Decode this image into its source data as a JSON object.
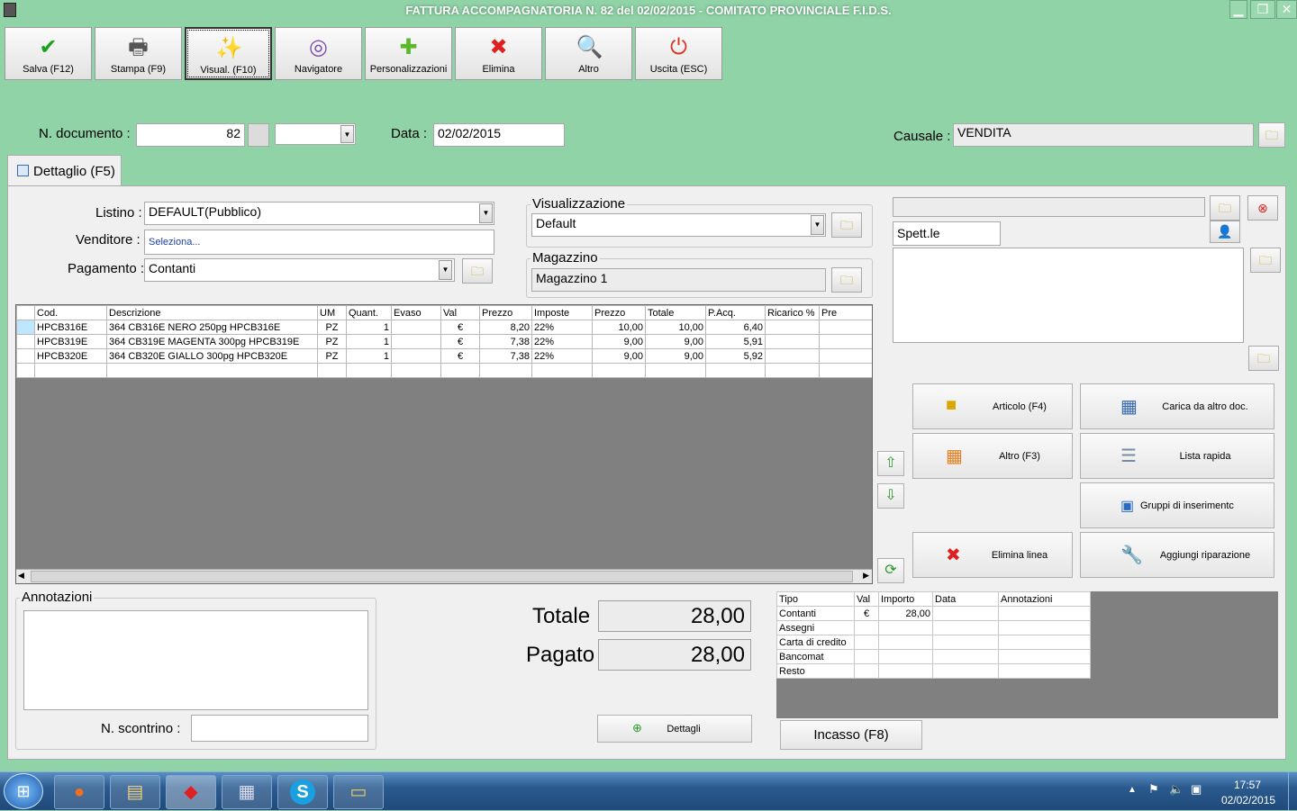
{
  "window": {
    "title": "FATTURA ACCOMPAGNATORIA N. 82 del 02/02/2015 - COMITATO PROVINCIALE F.I.D.S."
  },
  "toolbar": [
    {
      "label": "Salva (F12)",
      "icon": "check-icon",
      "glyph": "✔",
      "color": "#1aa31a"
    },
    {
      "label": "Stampa (F9)",
      "icon": "printer-icon",
      "glyph": "🖶",
      "color": "#555"
    },
    {
      "label": "Visual. (F10)",
      "icon": "magic-wand-icon",
      "glyph": "✨",
      "color": "#d4a000"
    },
    {
      "label": "Navigatore",
      "icon": "compass-icon",
      "glyph": "◎",
      "color": "#7a4ab0"
    },
    {
      "label": "Personalizzazioni",
      "icon": "puzzle-icon",
      "glyph": "✚",
      "color": "#5cb82a"
    },
    {
      "label": "Elimina",
      "icon": "delete-x-icon",
      "glyph": "✖",
      "color": "#e02020"
    },
    {
      "label": "Altro",
      "icon": "search-icon",
      "glyph": "🔍",
      "color": "#2060c0"
    },
    {
      "label": "Uscita (ESC)",
      "icon": "power-icon",
      "glyph": "⏻",
      "color": "#e03020"
    }
  ],
  "header": {
    "doc_label": "N. documento :",
    "doc_number": "82",
    "data_label": "Data :",
    "data_value": "02/02/2015",
    "causale_label": "Causale :",
    "causale_value": "VENDITA"
  },
  "tab": {
    "label": "Dettaglio (F5)"
  },
  "form": {
    "listino_label": "Listino :",
    "listino_value": "DEFAULT(Pubblico)",
    "venditore_label": "Venditore :",
    "venditore_value": "Seleziona...",
    "pagamento_label": "Pagamento :",
    "pagamento_value": "Contanti",
    "visualizzazione_label": "Visualizzazione",
    "visualizzazione_value": "Default",
    "magazzino_label": "Magazzino",
    "magazzino_value": "Magazzino 1"
  },
  "customer": {
    "salutation": "Spett.le"
  },
  "grid": {
    "columns": [
      "Cod.",
      "Descrizione",
      "UM",
      "Quant.",
      "Evaso",
      "Val",
      "Prezzo",
      "Imposte",
      "Prezzo",
      "Totale",
      "P.Acq.",
      "Ricarico %",
      "Pre"
    ],
    "rows": [
      [
        "HPCB316E",
        "364 CB316E NERO 250pg HPCB316E",
        "PZ",
        "1",
        "",
        "€",
        "8,20",
        "22%",
        "10,00",
        "10,00",
        "6,40",
        "",
        ""
      ],
      [
        "HPCB319E",
        "364 CB319E MAGENTA 300pg HPCB319E",
        "PZ",
        "1",
        "",
        "€",
        "7,38",
        "22%",
        "9,00",
        "9,00",
        "5,91",
        "",
        ""
      ],
      [
        "HPCB320E",
        "364 CB320E GIALLO 300pg HPCB320E",
        "PZ",
        "1",
        "",
        "€",
        "7,38",
        "22%",
        "9,00",
        "9,00",
        "5,92",
        "",
        ""
      ]
    ]
  },
  "actions": {
    "articolo": "Articolo (F4)",
    "carica": "Carica da altro doc.",
    "altro": "Altro (F3)",
    "lista": "Lista rapida",
    "gruppi": "Gruppi di inserimentc",
    "elimina_linea": "Elimina linea",
    "riparazione": "Aggiungi riparazione"
  },
  "annotazioni": {
    "label": "Annotazioni",
    "scontrino_label": "N. scontrino :"
  },
  "totals": {
    "totale_label": "Totale",
    "totale_value": "28,00",
    "pagato_label": "Pagato",
    "pagato_value": "28,00",
    "dettagli": "Dettagli"
  },
  "payments": {
    "columns": [
      "Tipo",
      "Val",
      "Importo",
      "Data",
      "Annotazioni"
    ],
    "rows": [
      [
        "Contanti",
        "€",
        "28,00",
        "",
        ""
      ],
      [
        "Assegni",
        "",
        "",
        "",
        ""
      ],
      [
        "Carta di credito",
        "",
        "",
        "",
        ""
      ],
      [
        "Bancomat",
        "",
        "",
        "",
        ""
      ],
      [
        "Resto",
        "",
        "",
        "",
        ""
      ]
    ],
    "incasso": "Incasso (F8)"
  },
  "taskbar": {
    "time": "17:57",
    "date": "02/02/2015"
  }
}
